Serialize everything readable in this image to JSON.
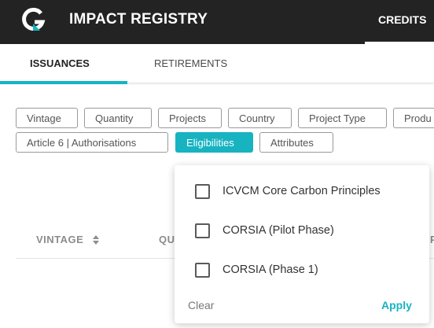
{
  "header": {
    "logo_icon": "g-logo-icon",
    "title": "IMPACT REGISTRY",
    "nav_credits": "CREDITS"
  },
  "tabs": [
    {
      "label": "ISSUANCES",
      "active": true
    },
    {
      "label": "RETIREMENTS",
      "active": false
    }
  ],
  "filters": [
    {
      "label": "Vintage",
      "active": false
    },
    {
      "label": "Quantity",
      "active": false
    },
    {
      "label": "Projects",
      "active": false
    },
    {
      "label": "Country",
      "active": false
    },
    {
      "label": "Project Type",
      "active": false
    },
    {
      "label": "Produ",
      "active": false
    },
    {
      "label": "Article 6 | Authorisations",
      "active": false
    },
    {
      "label": "Eligibilities",
      "active": true
    },
    {
      "label": "Attributes",
      "active": false
    }
  ],
  "table": {
    "columns": [
      "VINTAGE",
      "QU",
      "P"
    ],
    "sort_icon": "sort-updown-icon"
  },
  "dropdown": {
    "options": [
      {
        "label": "ICVCM Core Carbon Principles",
        "checked": false
      },
      {
        "label": "CORSIA (Pilot Phase)",
        "checked": false
      },
      {
        "label": "CORSIA (Phase 1)",
        "checked": false
      }
    ],
    "clear_label": "Clear",
    "apply_label": "Apply"
  },
  "colors": {
    "accent": "#17b3c1",
    "header_bg": "#232323"
  }
}
